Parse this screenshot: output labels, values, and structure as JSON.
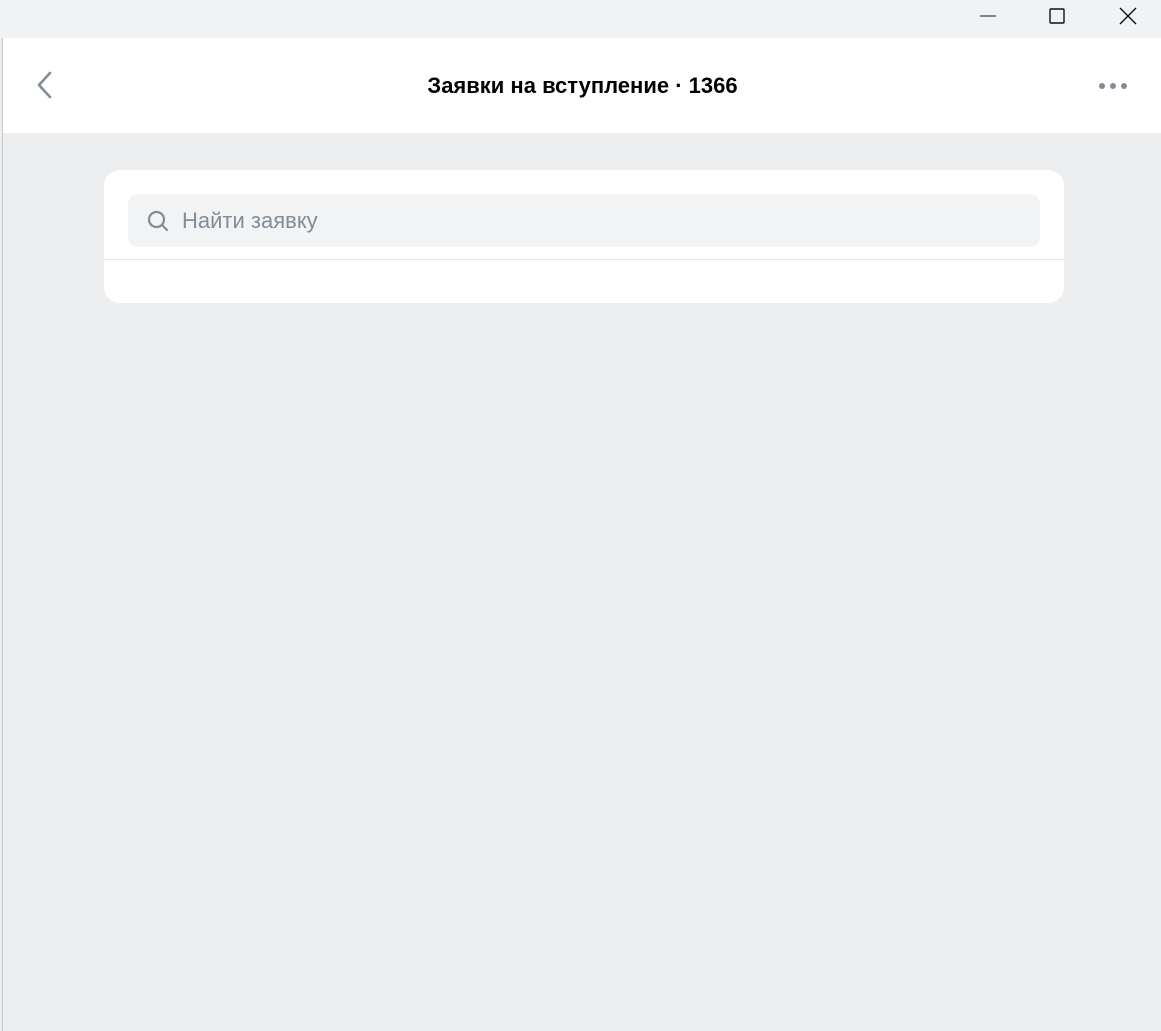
{
  "window": {
    "controls": {
      "minimize_icon": "minimize-icon",
      "maximize_icon": "maximize-icon",
      "close_icon": "close-icon"
    }
  },
  "header": {
    "title": "Заявки на вступление · 1366",
    "back_icon": "chevron-left-icon",
    "more_icon": "more-horizontal-icon"
  },
  "search": {
    "placeholder": "Найти заявку",
    "value": "",
    "icon": "search-icon"
  },
  "colors": {
    "background": "#edeef0",
    "header_bg": "#ffffff",
    "card_bg": "#ffffff",
    "search_bg": "#f2f3f5",
    "placeholder": "#818c99",
    "icon": "#818c99"
  }
}
